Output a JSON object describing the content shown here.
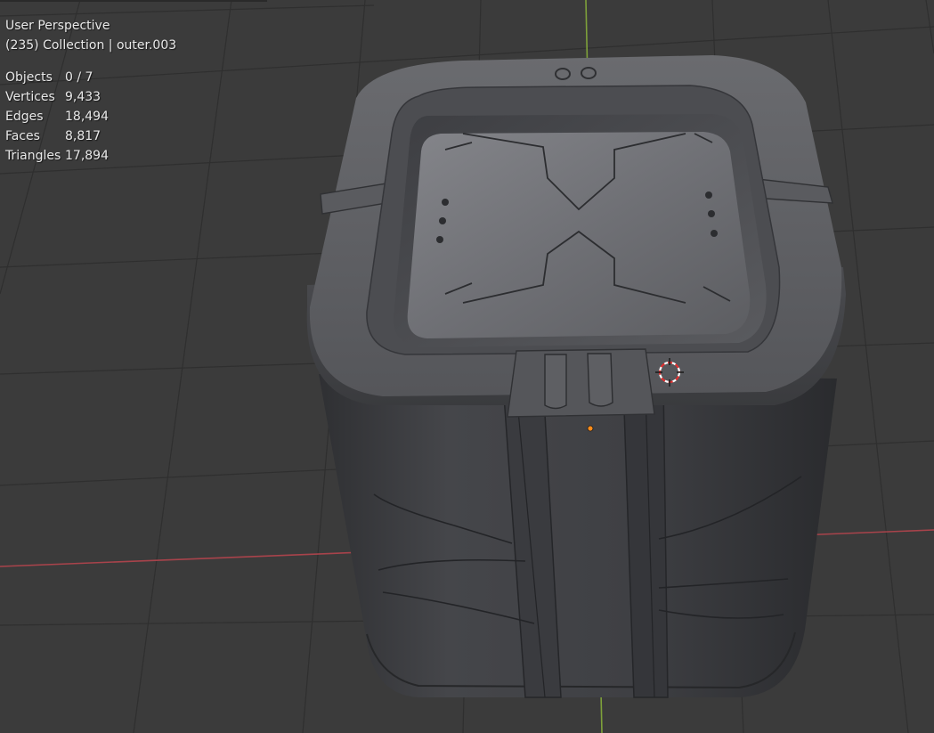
{
  "viewport": {
    "view_name": "User Perspective",
    "context_line": "(235) Collection | outer.003",
    "stats": [
      {
        "label": "Objects",
        "value": "0 / 7"
      },
      {
        "label": "Vertices",
        "value": "9,433"
      },
      {
        "label": "Edges",
        "value": "18,494"
      },
      {
        "label": "Faces",
        "value": "8,817"
      },
      {
        "label": "Triangles",
        "value": "17,894"
      }
    ]
  },
  "colors": {
    "background": "#3b3b3b",
    "grid_line": "#2e2e2e",
    "x_axis": "#a8434b",
    "y_axis": "#7ea13a",
    "model_body": "#4a4b4f",
    "model_top": "#5e5f63",
    "origin_dot": "#ff8c1a",
    "cursor_ring": "#e03030"
  }
}
